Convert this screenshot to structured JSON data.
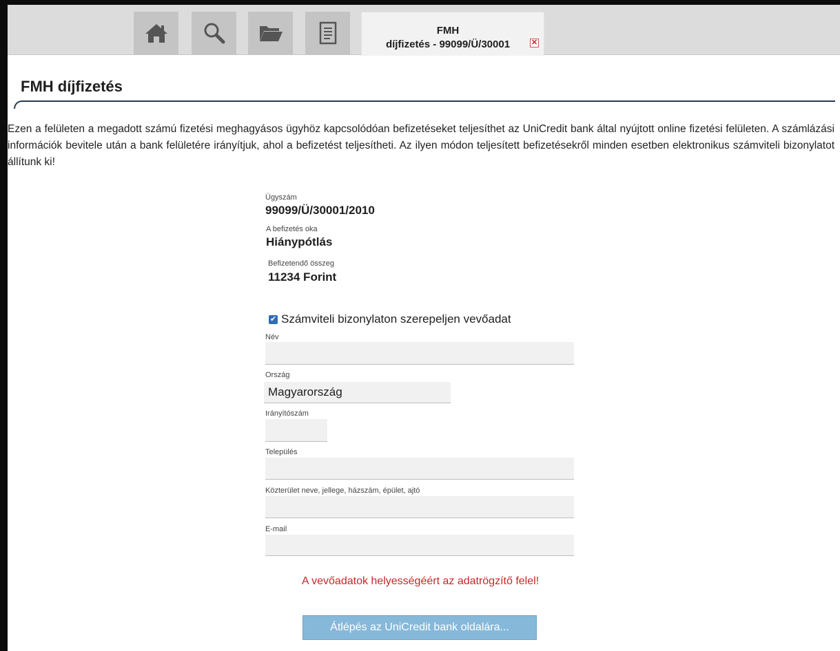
{
  "tabs": {
    "icon_tabs": [
      {
        "icon": "home-icon"
      },
      {
        "icon": "search-icon"
      },
      {
        "icon": "folder-icon"
      },
      {
        "icon": "document-icon"
      }
    ],
    "active_tab": {
      "line1": "FMH",
      "line2": "díjfizetés - 99099/Ü/30001",
      "close_glyph": "✕"
    }
  },
  "page": {
    "title": "FMH díjfizetés",
    "intro": "Ezen a felületen a megadott számú fizetési meghagyásos ügyhöz kapcsolódóan befizetéseket teljesíthet az UniCredit bank által nyújtott online fizetési felületen. A számlázási információk bevitele után a bank felületére irányítjuk, ahol a befizetést teljesítheti. Az ilyen módon teljesített befizetésekről minden esetben elektronikus számviteli bizonylatot állítunk ki!"
  },
  "summary": {
    "case_label": "Ügyszám",
    "case_value": "99099/Ü/30001/2010",
    "reason_label": "A befizetés oka",
    "reason_value": "Hiánypótlás",
    "amount_label": "Befizetendő összeg",
    "amount_value": "11234 Forint"
  },
  "form": {
    "checkbox_label": "Számviteli bizonylaton szerepeljen vevőadat",
    "checkbox_checked": true,
    "name_label": "Név",
    "name_value": "",
    "country_label": "Ország",
    "country_value": "Magyarország",
    "zip_label": "Irányítószám",
    "zip_value": "",
    "city_label": "Település",
    "city_value": "",
    "street_label": "Közterület neve, jellege, házszám, épület, ajtó",
    "street_value": "",
    "email_label": "E-mail",
    "email_value": ""
  },
  "warning": "A vevőadatok helyességéért az adatrögzítő felel!",
  "submit_label": "Átlépés az UniCredit bank oldalára..."
}
